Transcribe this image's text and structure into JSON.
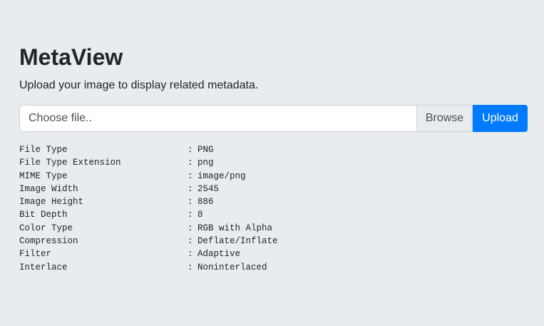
{
  "header": {
    "title": "MetaView",
    "subtitle": "Upload your image to display related metadata."
  },
  "upload_form": {
    "file_placeholder": "Choose file..",
    "browse_label": "Browse",
    "upload_label": "Upload",
    "upload_button_color": "#007bff"
  },
  "metadata": {
    "separator": ":",
    "rows": [
      {
        "key": "File Type",
        "value": "PNG"
      },
      {
        "key": "File Type Extension",
        "value": "png"
      },
      {
        "key": "MIME Type",
        "value": "image/png"
      },
      {
        "key": "Image Width",
        "value": "2545"
      },
      {
        "key": "Image Height",
        "value": "886"
      },
      {
        "key": "Bit Depth",
        "value": "8"
      },
      {
        "key": "Color Type",
        "value": "RGB with Alpha"
      },
      {
        "key": "Compression",
        "value": "Deflate/Inflate"
      },
      {
        "key": "Filter",
        "value": "Adaptive"
      },
      {
        "key": "Interlace",
        "value": "Noninterlaced"
      }
    ]
  }
}
